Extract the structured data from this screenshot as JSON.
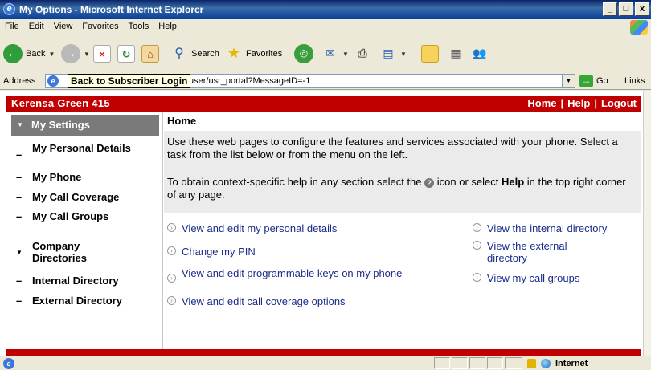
{
  "window": {
    "title": "My Options - Microsoft Internet Explorer",
    "min_glyph": "_",
    "max_glyph": "□",
    "close_glyph": "x"
  },
  "menu": [
    "File",
    "Edit",
    "View",
    "Favorites",
    "Tools",
    "Help"
  ],
  "toolbar": {
    "back_label": "Back",
    "search_label": "Search",
    "favorites_label": "Favorites"
  },
  "address": {
    "label": "Address",
    "url": "user/usr_portal?MessageID=-1",
    "tooltip": "Back to Subscriber Login",
    "go_label": "Go",
    "links_label": "Links"
  },
  "header": {
    "user_name": "Kerensa Green 415",
    "links": [
      "Home",
      "Help",
      "Logout"
    ],
    "separator": "|"
  },
  "sidebar": {
    "section1": "My Settings",
    "items1": [
      "My Personal Details",
      "My Phone",
      "My Call Coverage",
      "My Call Groups"
    ],
    "section2": "Company Directories",
    "items2": [
      "Internal Directory",
      "External Directory"
    ]
  },
  "main": {
    "title": "Home",
    "intro": "Use these web pages to configure the features and services associated with your phone. Select a task from the list below or from the menu on the left.",
    "help_text_before": "To obtain context-specific help in any section select the",
    "help_text_middle": "icon or select",
    "help_text_bold": "Help",
    "help_text_after": "in the top right corner of any page.",
    "tasks_left": [
      "View and edit my personal details",
      "Change my PIN",
      "View and edit programmable keys on my phone",
      "View and edit call coverage options"
    ],
    "tasks_right": [
      "View the internal directory",
      "View the external directory",
      "View my call groups"
    ]
  },
  "status": {
    "zone": "Internet"
  }
}
